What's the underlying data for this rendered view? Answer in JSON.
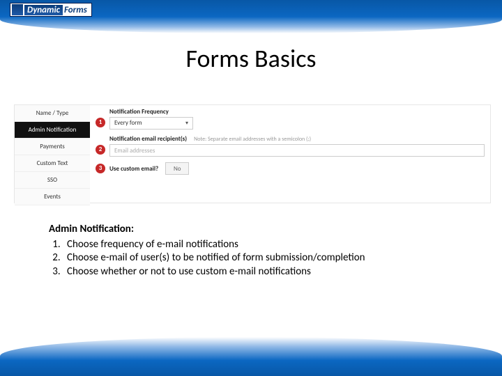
{
  "logo": {
    "dynamic": "Dynamic",
    "forms": "Forms"
  },
  "title": "Forms Basics",
  "tabs": {
    "name_type": "Name / Type",
    "admin_notification": "Admin Notification",
    "payments": "Payments",
    "custom_text": "Custom Text",
    "sso": "SSO",
    "events": "Events"
  },
  "badges": {
    "one": "1",
    "two": "2",
    "three": "3"
  },
  "fields": {
    "freq_label": "Notification Frequency",
    "freq_value": "Every form",
    "recipients_label": "Notification email recipient(s)",
    "recipients_hint": "Note: Separate email addresses with a semicolon (;)",
    "recipients_placeholder": "Email addresses",
    "custom_label": "Use custom email?",
    "custom_value": "No"
  },
  "body": {
    "heading": "Admin Notification:",
    "item1": "Choose frequency of e-mail notifications",
    "item2": "Choose e-mail of user(s) to be notified of form submission/completion",
    "item3": "Choose whether or not to use custom e-mail notifications"
  }
}
